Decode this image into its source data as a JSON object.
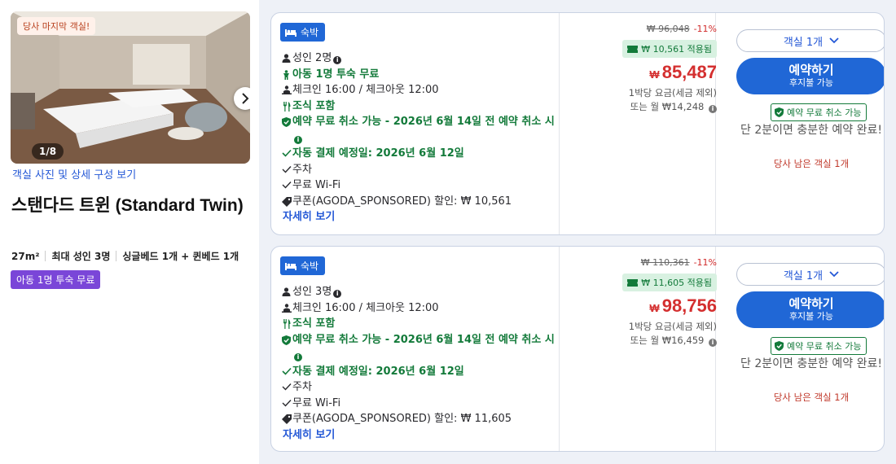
{
  "room": {
    "photo_badge": "당사 마지막 객실!",
    "photo_counter": "1/8",
    "photo_link": "객실 사진 및 상세 구성 보기",
    "title": "스탠다드 트윈 (Standard Twin)",
    "specs": [
      "27m²",
      "최대 성인 3명",
      "싱글베드 1개 + 퀸베드 1개"
    ],
    "tag": "아동 1명 투숙 무료"
  },
  "offers": [
    {
      "stay_type": "숙박",
      "features": [
        {
          "icon": "person-icon",
          "text": "성인 2명",
          "info": true,
          "green": false
        },
        {
          "icon": "child-icon",
          "text": "아동 1명 투숙 무료",
          "info": false,
          "green": true
        },
        {
          "icon": "checkin-icon",
          "text": "체크인 16:00 / 체크아웃 12:00",
          "info": false,
          "green": false
        },
        {
          "icon": "fork-knife-icon",
          "text": "조식 포함",
          "info": false,
          "green": true
        },
        {
          "icon": "shield-icon",
          "text": "예약 무료 취소 가능 - 2026년 6월 14일 전 예약 취소 시",
          "info": true,
          "green": true
        },
        {
          "icon": "check-icon",
          "text": "자동 결제 예정일: 2026년 6월 12일",
          "info": false,
          "green": true
        },
        {
          "icon": "check-icon",
          "text": "주차",
          "info": false,
          "green": false
        },
        {
          "icon": "check-icon",
          "text": "무료 Wi-Fi",
          "info": false,
          "green": false
        },
        {
          "icon": "tag-icon",
          "text": "쿠폰(AGODA_SPONSORED) 할인: ₩ 10,561",
          "info": false,
          "green": false
        }
      ],
      "more_link": "자세히 보기",
      "old_price": "₩ 96,048",
      "discount": "-11%",
      "coupon": "₩ 10,561 적용됨",
      "currency": "₩",
      "price": "85,487",
      "price_note_1": "1박당 요금(세금 제외)",
      "price_note_2": "또는 월 ₩14,248",
      "room_select": "객실 1개",
      "book_label": "예약하기",
      "book_sub": "후지불 가능",
      "cancel_badge": "예약 무료 취소 가능",
      "quick_note": "단 2분이면 충분한 예약 완료!",
      "left_note": "당사 남은 객실 1개"
    },
    {
      "stay_type": "숙박",
      "features": [
        {
          "icon": "person-icon",
          "text": "성인 3명",
          "info": true,
          "green": false
        },
        {
          "icon": "checkin-icon",
          "text": "체크인 16:00 / 체크아웃 12:00",
          "info": false,
          "green": false
        },
        {
          "icon": "fork-knife-icon",
          "text": "조식 포함",
          "info": false,
          "green": true
        },
        {
          "icon": "shield-icon",
          "text": "예약 무료 취소 가능 - 2026년 6월 14일 전 예약 취소 시",
          "info": true,
          "green": true
        },
        {
          "icon": "check-icon",
          "text": "자동 결제 예정일: 2026년 6월 12일",
          "info": false,
          "green": true
        },
        {
          "icon": "check-icon",
          "text": "주차",
          "info": false,
          "green": false
        },
        {
          "icon": "check-icon",
          "text": "무료 Wi-Fi",
          "info": false,
          "green": false
        },
        {
          "icon": "tag-icon",
          "text": "쿠폰(AGODA_SPONSORED) 할인: ₩ 11,605",
          "info": false,
          "green": false
        }
      ],
      "more_link": "자세히 보기",
      "old_price": "₩ 110,361",
      "discount": "-11%",
      "coupon": "₩ 11,605 적용됨",
      "currency": "₩",
      "price": "98,756",
      "price_note_1": "1박당 요금(세금 제외)",
      "price_note_2": "또는 월 ₩16,459",
      "room_select": "객실 1개",
      "book_label": "예약하기",
      "book_sub": "후지불 가능",
      "cancel_badge": "예약 무료 취소 가능",
      "quick_note": "단 2분이면 충분한 예약 완료!",
      "left_note": "당사 남은 객실 1개"
    }
  ],
  "colors": {
    "brand_blue": "#2067d6",
    "link_blue": "#2458d6",
    "green": "#137a3a",
    "price_red": "#d42f2f",
    "purple_tag": "#7a46d8"
  }
}
